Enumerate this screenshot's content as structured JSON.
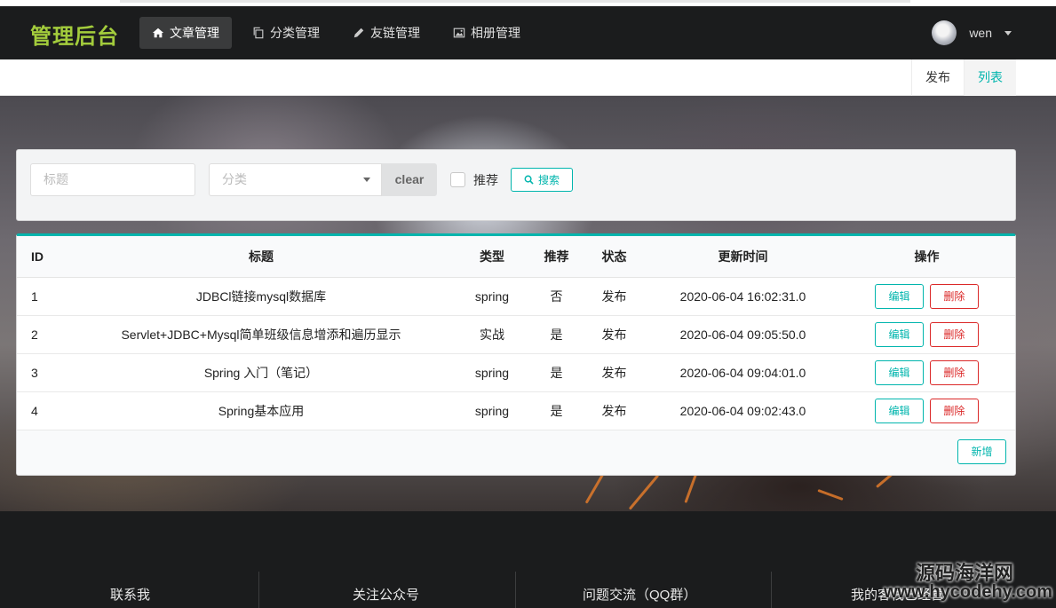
{
  "header": {
    "logo": "管理后台",
    "nav": [
      {
        "label": "文章管理",
        "icon": "home-icon",
        "active": true
      },
      {
        "label": "分类管理",
        "icon": "copy-icon",
        "active": false
      },
      {
        "label": "友链管理",
        "icon": "pencil-icon",
        "active": false
      },
      {
        "label": "相册管理",
        "icon": "image-icon",
        "active": false
      }
    ],
    "user": {
      "name": "wen"
    }
  },
  "submenu": {
    "publish": "发布",
    "list": "列表"
  },
  "search": {
    "title_placeholder": "标题",
    "category_placeholder": "分类",
    "clear_label": "clear",
    "recommend_label": "推荐",
    "search_label": "搜索"
  },
  "table": {
    "headers": {
      "id": "ID",
      "title": "标题",
      "type": "类型",
      "recommend": "推荐",
      "status": "状态",
      "updated": "更新时间",
      "ops": "操作"
    },
    "rows": [
      {
        "id": "1",
        "title": "JDBCl链接mysql数据库",
        "type": "spring",
        "recommend": "否",
        "status": "发布",
        "updated": "2020-06-04 16:02:31.0"
      },
      {
        "id": "2",
        "title": "Servlet+JDBC+Mysql简单班级信息增添和遍历显示",
        "type": "实战",
        "recommend": "是",
        "status": "发布",
        "updated": "2020-06-04 09:05:50.0"
      },
      {
        "id": "3",
        "title": "Spring 入门（笔记）",
        "type": "spring",
        "recommend": "是",
        "status": "发布",
        "updated": "2020-06-04 09:04:01.0"
      },
      {
        "id": "4",
        "title": "Spring基本应用",
        "type": "spring",
        "recommend": "是",
        "status": "发布",
        "updated": "2020-06-04 09:02:43.0"
      }
    ],
    "edit_label": "编辑",
    "delete_label": "删除",
    "add_label": "新增"
  },
  "footer": {
    "columns": [
      "联系我",
      "关注公众号",
      "问题交流（QQ群）",
      "我的客栈已经营"
    ]
  },
  "watermark": {
    "cn": "源码海洋网",
    "url": "www.hycodehy.com"
  },
  "colors": {
    "accent": "#00b5ad",
    "danger": "#db2828",
    "logo": "#a3cc3c",
    "header_bg": "#1b1c1d"
  }
}
